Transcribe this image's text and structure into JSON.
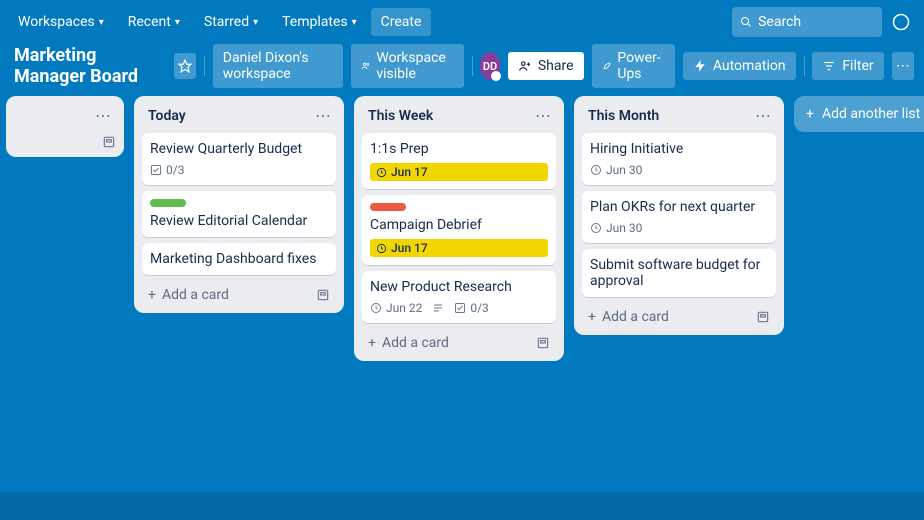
{
  "nav": {
    "workspaces": "Workspaces",
    "recent": "Recent",
    "starred": "Starred",
    "templates": "Templates",
    "create": "Create",
    "search_placeholder": "Search"
  },
  "boardbar": {
    "title": "Marketing Manager Board",
    "workspace": "Daniel Dixon's workspace",
    "visibility": "Workspace visible",
    "avatar_initials": "DD",
    "share": "Share",
    "powerups": "Power-Ups",
    "automation": "Automation",
    "filter": "Filter"
  },
  "lists": {
    "today": {
      "title": "Today",
      "add": "Add a card",
      "cards": {
        "c0": {
          "title": "Review Quarterly Budget",
          "checklist": "0/3"
        },
        "c1": {
          "title": "Review Editorial Calendar"
        },
        "c2": {
          "title": "Marketing Dashboard fixes"
        }
      }
    },
    "thisweek": {
      "title": "This Week",
      "add": "Add a card",
      "cards": {
        "c0": {
          "title": "1:1s Prep",
          "due": "Jun 17"
        },
        "c1": {
          "title": "Campaign Debrief",
          "due": "Jun 17"
        },
        "c2": {
          "title": "New Product Research",
          "due": "Jun 22",
          "checklist": "0/3"
        }
      }
    },
    "thismonth": {
      "title": "This Month",
      "add": "Add a card",
      "cards": {
        "c0": {
          "title": "Hiring Initiative",
          "due": "Jun 30"
        },
        "c1": {
          "title": "Plan OKRs for next quarter",
          "due": "Jun 30"
        },
        "c2": {
          "title": "Submit software budget for approval"
        }
      }
    }
  },
  "add_list": "Add another list"
}
